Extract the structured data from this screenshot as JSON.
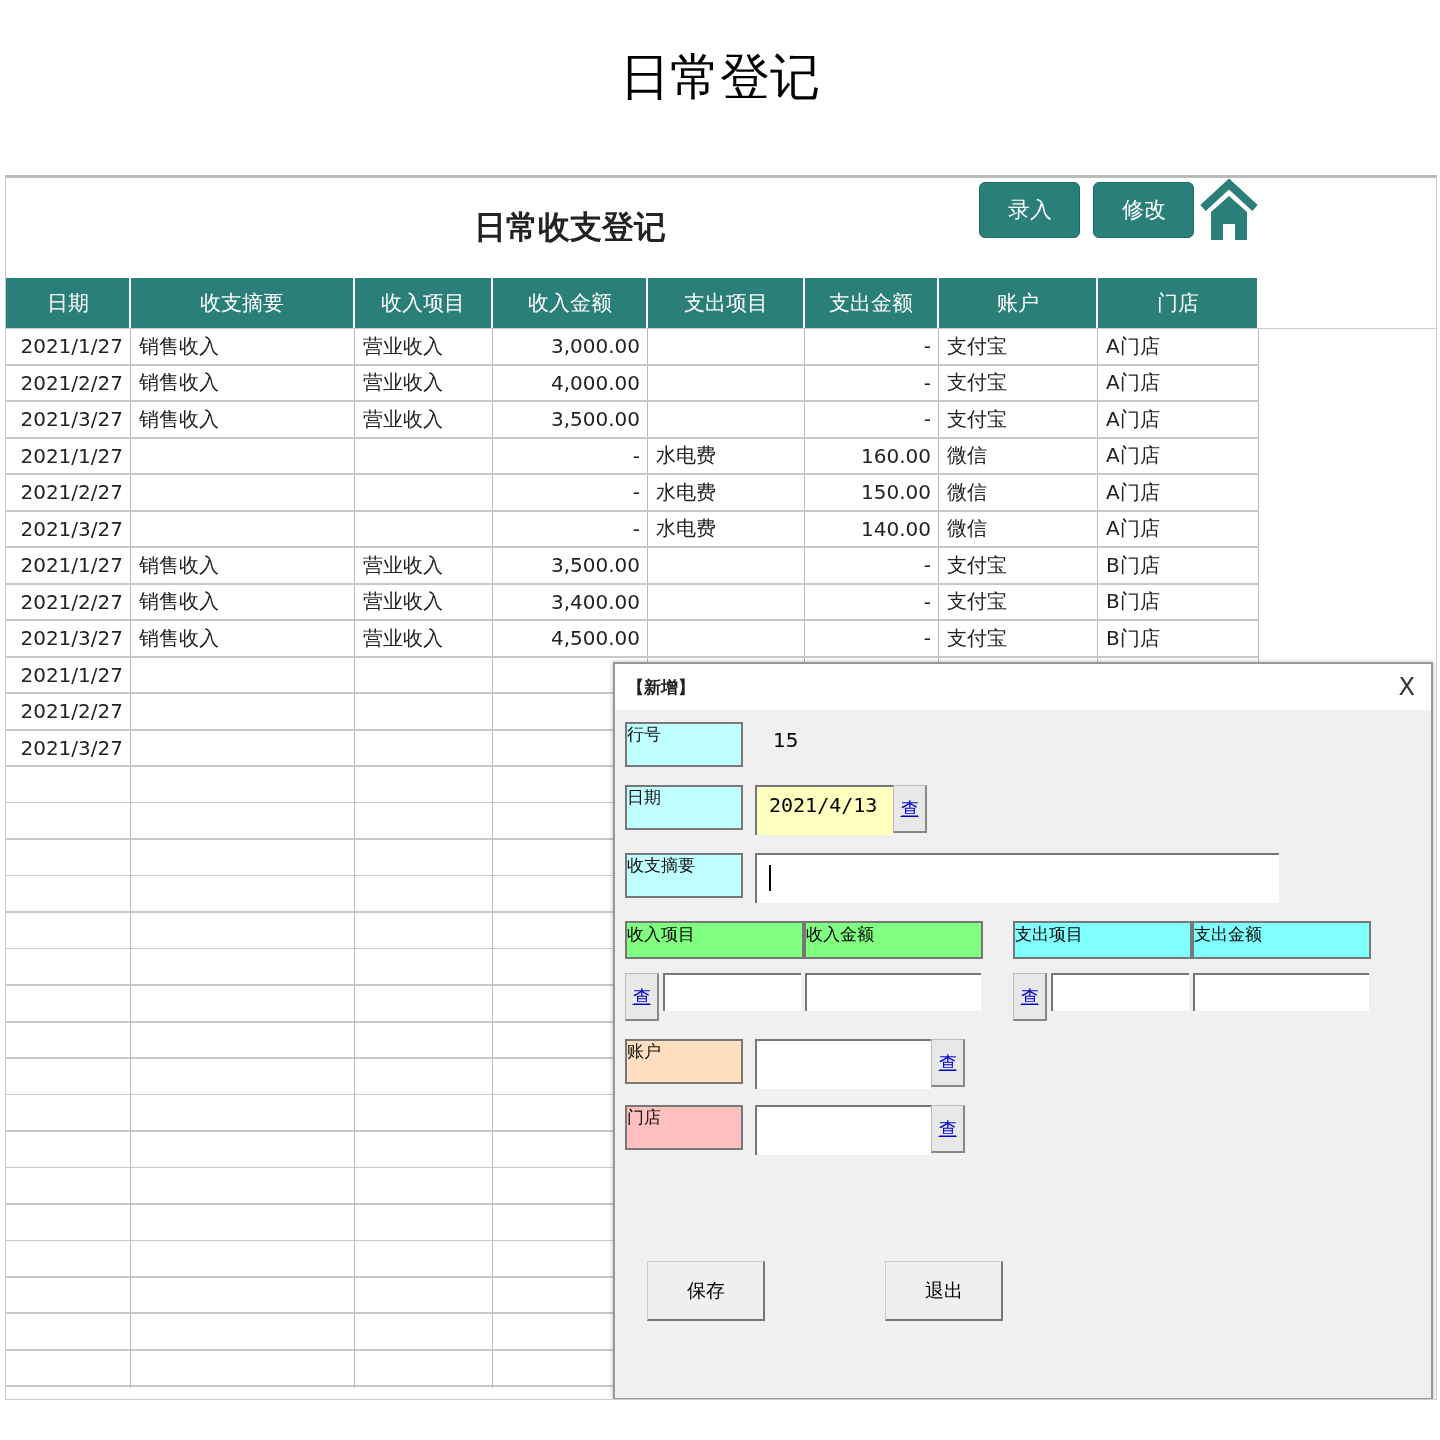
{
  "page_title": "日常登记",
  "sheet": {
    "title": "日常收支登记",
    "buttons": [
      "录入",
      "修改"
    ],
    "columns": [
      "日期",
      "收支摘要",
      "收入项目",
      "收入金额",
      "支出项目",
      "支出金额",
      "账户",
      "门店"
    ],
    "rows": [
      [
        "2021/1/27",
        "销售收入",
        "营业收入",
        "3,000.00",
        null,
        "-",
        "支付宝",
        "A门店"
      ],
      [
        "2021/2/27",
        "销售收入",
        "营业收入",
        "4,000.00",
        null,
        "-",
        "支付宝",
        "A门店"
      ],
      [
        "2021/3/27",
        "销售收入",
        "营业收入",
        "3,500.00",
        null,
        "-",
        "支付宝",
        "A门店"
      ],
      [
        "2021/1/27",
        null,
        null,
        "-",
        "水电费",
        "160.00",
        "微信",
        "A门店"
      ],
      [
        "2021/2/27",
        null,
        null,
        "-",
        "水电费",
        "150.00",
        "微信",
        "A门店"
      ],
      [
        "2021/3/27",
        null,
        null,
        "-",
        "水电费",
        "140.00",
        "微信",
        "A门店"
      ],
      [
        "2021/1/27",
        "销售收入",
        "营业收入",
        "3,500.00",
        null,
        "-",
        "支付宝",
        "B门店"
      ],
      [
        "2021/2/27",
        "销售收入",
        "营业收入",
        "3,400.00",
        null,
        "-",
        "支付宝",
        "B门店"
      ],
      [
        "2021/3/27",
        "销售收入",
        "营业收入",
        "4,500.00",
        null,
        "-",
        "支付宝",
        "B门店"
      ],
      [
        "2021/1/27",
        null,
        null,
        null,
        null,
        null,
        null,
        null
      ],
      [
        "2021/2/27",
        null,
        null,
        null,
        null,
        null,
        null,
        null
      ],
      [
        "2021/3/27",
        null,
        null,
        null,
        null,
        null,
        null,
        null
      ]
    ]
  },
  "dialog": {
    "title": "【新增】",
    "close": "X",
    "row_number": {
      "label": "行号",
      "value": "15",
      "color": "#c0ffff"
    },
    "date": {
      "label": "日期",
      "value": "2021/4/13",
      "color": "#c0ffff",
      "lookup": "查"
    },
    "summary": {
      "label": "收支摘要",
      "color": "#c0ffff",
      "focused": true
    },
    "groups": [
      {
        "color": "#80ff80",
        "lookup": "查",
        "columns": [
          "收入项目",
          "收入金额"
        ]
      },
      {
        "color": "#80ffff",
        "lookup": "查",
        "columns": [
          "支出项目",
          "支出金额"
        ]
      }
    ],
    "account": {
      "label": "账户",
      "color": "#ffdfbf",
      "lookup": "查"
    },
    "store": {
      "label": "门店",
      "color": "#ffc0c0",
      "lookup": "查"
    },
    "buttons": [
      "保存",
      "退出"
    ]
  }
}
